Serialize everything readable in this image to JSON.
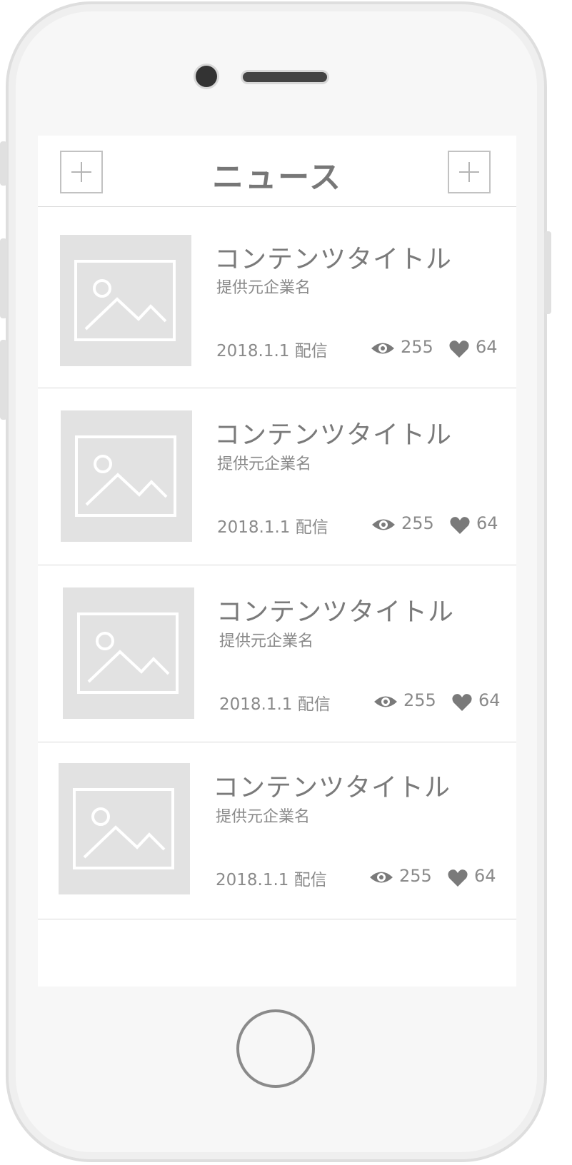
{
  "header": {
    "title": "ニュース",
    "left_button_icon": "plus-icon",
    "right_button_icon": "plus-icon"
  },
  "news_items": [
    {
      "title": "コンテンツタイトル",
      "company": "提供元企業名",
      "date": "2018.1.1 配信",
      "views": "255",
      "likes": "64",
      "thumbnail_icon": "image-placeholder-icon"
    },
    {
      "title": "コンテンツタイトル",
      "company": "提供元企業名",
      "date": "2018.1.1 配信",
      "views": "255",
      "likes": "64",
      "thumbnail_icon": "image-placeholder-icon"
    },
    {
      "title": "コンテンツタイトル",
      "company": "提供元企業名",
      "date": "2018.1.1 配信",
      "views": "255",
      "likes": "64",
      "thumbnail_icon": "image-placeholder-icon"
    },
    {
      "title": "コンテンツタイトル",
      "company": "提供元企業名",
      "date": "2018.1.1 配信",
      "views": "255",
      "likes": "64",
      "thumbnail_icon": "image-placeholder-icon"
    }
  ],
  "icons": {
    "views": "eye-icon",
    "likes": "heart-icon"
  },
  "colors": {
    "text_primary": "#7a7a7a",
    "text_secondary": "#8a8a8a",
    "thumbnail_bg": "#e2e2e2",
    "divider": "#d9d9d9"
  }
}
